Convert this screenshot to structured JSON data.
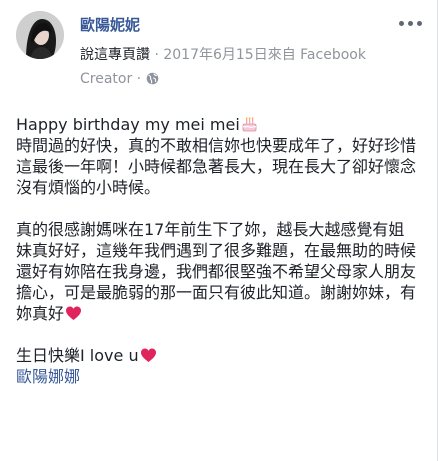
{
  "post": {
    "author_name": "歐陽妮妮",
    "byline_label": "說這專頁讚",
    "separator": " · ",
    "timestamp": "2017年6月15日來自 Facebook Creator",
    "privacy_icon": "globe-icon",
    "more_icon": "more-options-icon",
    "avatar_icon": "profile-avatar"
  },
  "message": {
    "line1_text": "Happy birthday my mei mei",
    "line1_icon": "birthday-cake-emoji",
    "paragraph1": "時間過的好快，真的不敢相信妳也快要成年了，好好珍惜這最後一年啊！小時候都急著長大，現在長大了卻好懷念沒有煩惱的小時候。",
    "paragraph2": "真的很感謝媽咪在17年前生下了妳，越長大越感覺有姐妹真好好，這幾年我們遇到了很多難題，在最無助的時候還好有妳陪在我身邊，我們都很堅強不希望父母家人朋友擔心，可是最脆弱的那一面只有彼此知道。謝謝妳妹，有妳真好",
    "paragraph2_icon": "red-heart-emoji",
    "closing_text": "生日快樂I love u",
    "closing_icon": "red-heart-emoji",
    "mention": "歐陽娜娜"
  },
  "colors": {
    "link": "#385898",
    "text": "#1d2129",
    "meta": "#90949c",
    "heart": "#e0245e"
  }
}
